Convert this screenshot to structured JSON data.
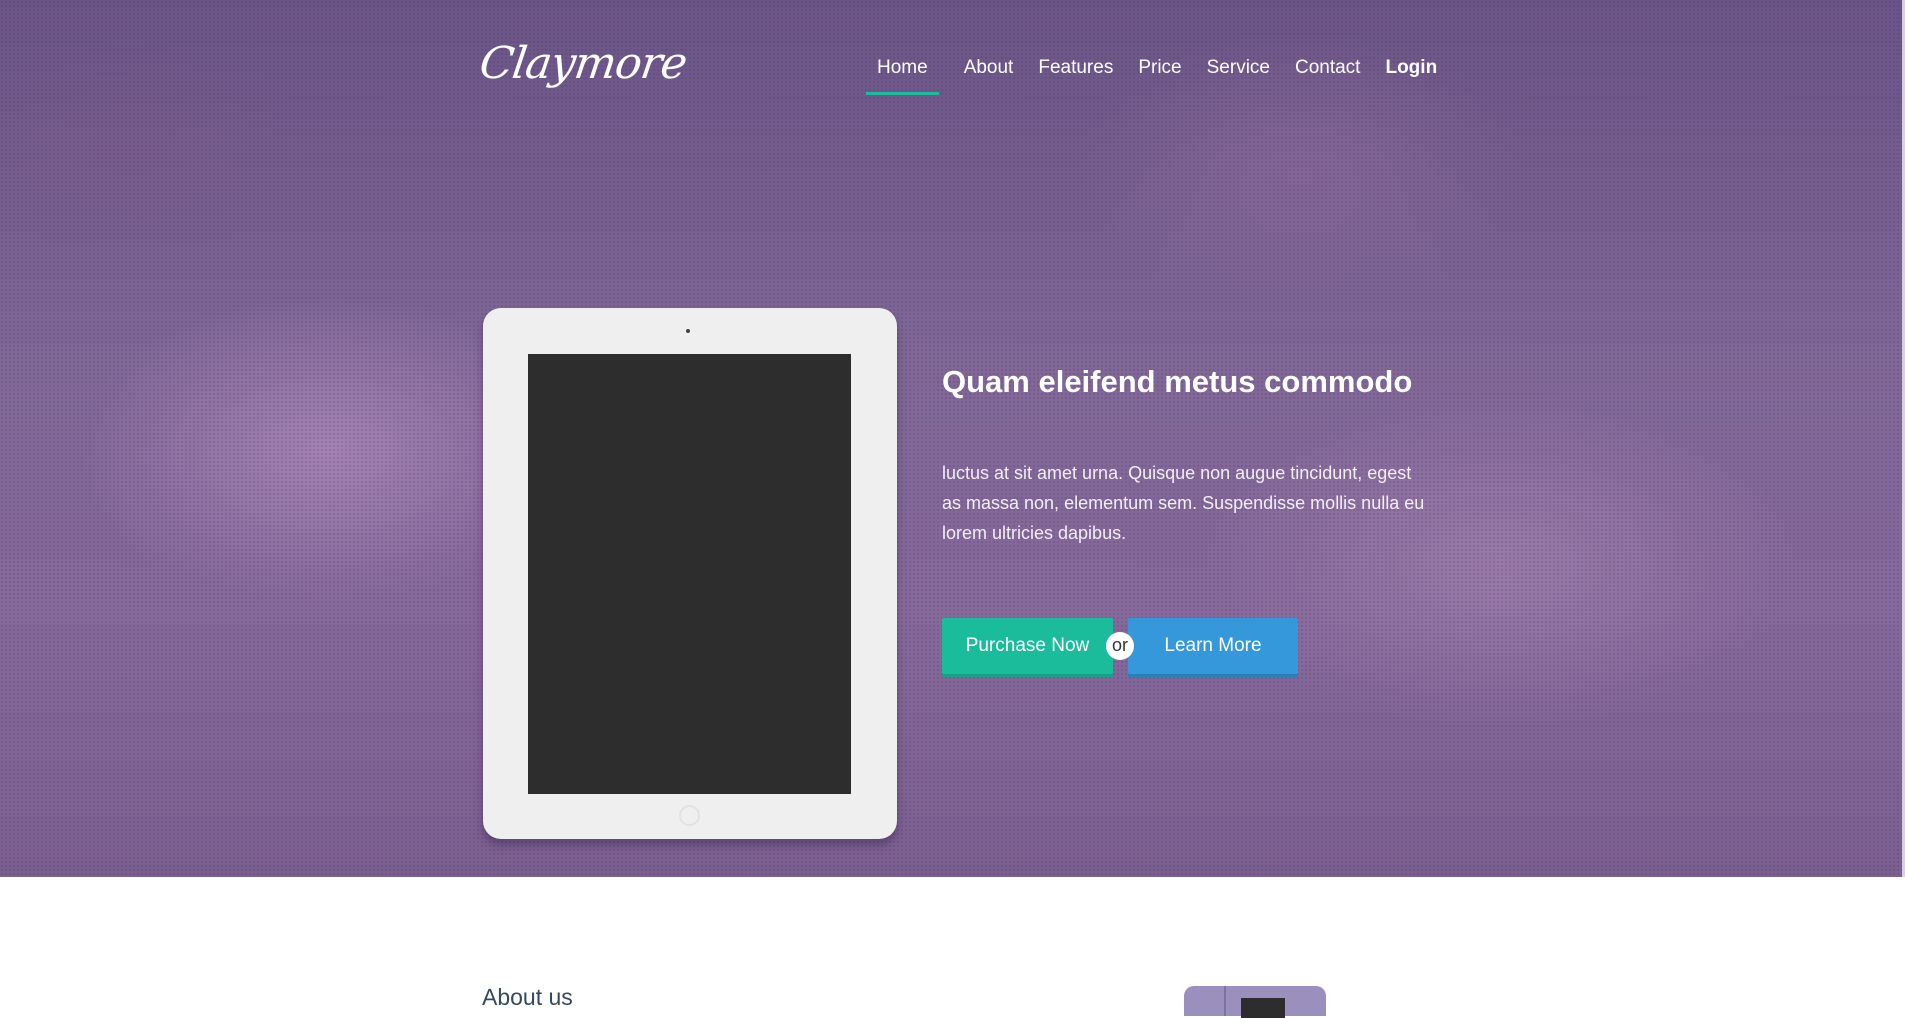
{
  "brand": {
    "logo_text": "Claymore"
  },
  "nav": {
    "items": [
      {
        "label": "Home",
        "active": true
      },
      {
        "label": "About",
        "active": false
      },
      {
        "label": "Features",
        "active": false
      },
      {
        "label": "Price",
        "active": false
      },
      {
        "label": "Service",
        "active": false
      },
      {
        "label": "Contact",
        "active": false
      },
      {
        "label": "Login",
        "active": false
      }
    ],
    "active_color": "#1abc9c"
  },
  "hero": {
    "title": "Quam eleifend metus commodo",
    "text": "luctus at sit amet urna. Quisque non augue tincidunt, egest as massa non, elementum sem. Suspendisse mollis nulla eu lorem ultricies dapibus.",
    "purchase_label": "Purchase Now",
    "or_label": "or",
    "learn_label": "Learn More",
    "purchase_color": "#1abc9c",
    "learn_color": "#3498db"
  },
  "about": {
    "title": "About us"
  }
}
